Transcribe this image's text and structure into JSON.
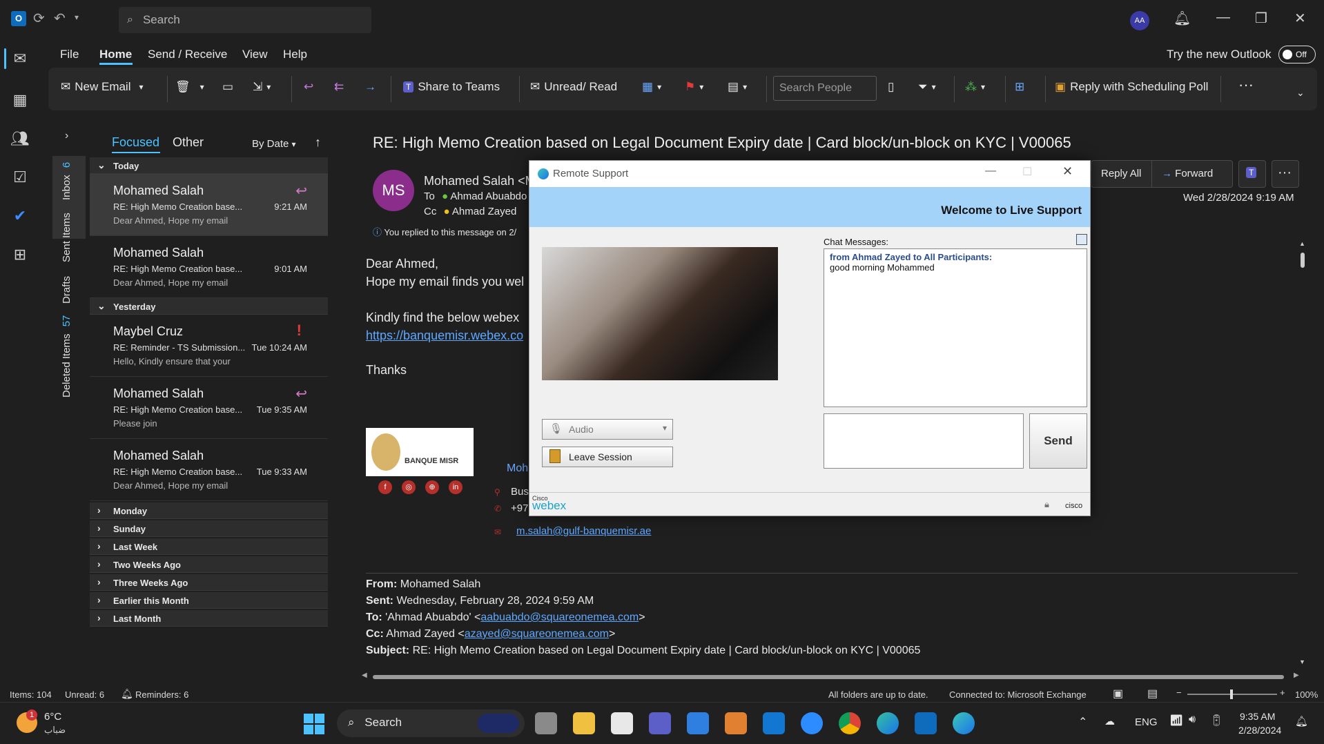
{
  "titlebar": {
    "search_placeholder": "Search",
    "avatar_initials": "AA"
  },
  "menu": {
    "file": "File",
    "home": "Home",
    "send_receive": "Send / Receive",
    "view": "View",
    "help": "Help",
    "try_new": "Try the new Outlook",
    "toggle": "Off"
  },
  "ribbon": {
    "new_email": "New Email",
    "share_teams": "Share to Teams",
    "unread_read": "Unread/ Read",
    "search_people": "Search People",
    "reply_poll": "Reply with Scheduling Poll"
  },
  "folders": {
    "inbox": "Inbox",
    "inbox_count": "6",
    "sent": "Sent Items",
    "drafts": "Drafts",
    "deleted": "Deleted Items",
    "deleted_count": "57"
  },
  "list": {
    "tab_focused": "Focused",
    "tab_other": "Other",
    "sort": "By Date",
    "groups_top": {
      "today": "Today",
      "yesterday": "Yesterday"
    },
    "messages": [
      {
        "from": "Mohamed Salah",
        "subject": "RE: High Memo Creation base...",
        "preview": "Dear Ahmed,   Hope my email",
        "time": "9:21 AM"
      },
      {
        "from": "Mohamed Salah",
        "subject": "RE: High Memo Creation base...",
        "preview": "Dear Ahmed,   Hope my email",
        "time": "9:01 AM"
      },
      {
        "from": "Maybel Cruz",
        "subject": "RE: Reminder -  TS Submission...",
        "preview": "Hello,  Kindly ensure that your",
        "time": "Tue 10:24 AM"
      },
      {
        "from": "Mohamed Salah",
        "subject": "RE: High Memo Creation base...",
        "preview": "Please join",
        "time": "Tue 9:35 AM"
      },
      {
        "from": "Mohamed Salah",
        "subject": "RE: High Memo Creation base...",
        "preview": "Dear Ahmed,   Hope my email",
        "time": "Tue 9:33 AM"
      }
    ],
    "groups": [
      "Monday",
      "Sunday",
      "Last Week",
      "Two Weeks Ago",
      "Three Weeks Ago",
      "Earlier this Month",
      "Last Month"
    ]
  },
  "reading": {
    "subject": "RE: High Memo Creation based on Legal Document Expiry date | Card block/un-block on KYC | V00065",
    "avatar": "MS",
    "sender": "Mohamed Salah <M",
    "to_label": "To",
    "to_value": "Ahmad Abuabdo",
    "cc_label": "Cc",
    "cc_value": "Ahmad Zayed",
    "replied_note": "You replied to this message on 2/",
    "reply_all": "Reply All",
    "forward": "Forward",
    "date": "Wed 2/28/2024 9:19 AM",
    "greeting": "Dear Ahmed,",
    "line1": "Hope my email finds you wel",
    "line2": "Kindly find the below webex",
    "link": "https://banquemisr.webex.co",
    "thanks": "Thanks",
    "logo_text": "BANQUE MISR",
    "sig_name": "Moh",
    "sig_bus": "Bus",
    "sig_phone": "+97",
    "sig_email": "m.salah@gulf-banquemisr.ae",
    "from_lbl": "From:",
    "from_val": "Mohamed Salah",
    "sent_lbl": "Sent:",
    "sent_val": "Wednesday, February 28, 2024 9:59 AM",
    "to_lbl": "To:",
    "to_val_pre": "'Ahmad Abuabdo' <",
    "to_email": "aabuabdo@squareonemea.com",
    "cc_lbl": "Cc:",
    "cc_val_pre": "Ahmad Zayed <",
    "cc_email": "azayed@squareonemea.com",
    "subj_lbl": "Subject:",
    "subj_val": "RE: High Memo Creation based on Legal Document Expiry date | Card block/un-block on KYC | V00065",
    "gt": ">"
  },
  "dialog": {
    "title": "Remote Support",
    "welcome": "Welcome to Live Support",
    "audio": "Audio",
    "leave": "Leave  Session",
    "chat_label": "Chat Messages:",
    "chat_from": "from Ahmad Zayed to All Participants:",
    "chat_msg": "good morning Mohammed",
    "send": "Send",
    "brand_small": "Cisco",
    "brand": "webex",
    "cisco": "cisco"
  },
  "status": {
    "items": "Items: 104",
    "unread": "Unread: 6",
    "reminders": "Reminders: 6",
    "sync": "All folders are up to date.",
    "connected": "Connected to: Microsoft Exchange",
    "zoom": "100%"
  },
  "taskbar": {
    "temp": "6°C",
    "weather": "ضباب",
    "weather_badge": "1",
    "search": "Search",
    "lang": "ENG",
    "time": "9:35 AM",
    "date": "2/28/2024"
  },
  "colors": {
    "accent": "#4cc2ff",
    "avatar": "#8b2e8b",
    "band": "#a4d3fa"
  }
}
